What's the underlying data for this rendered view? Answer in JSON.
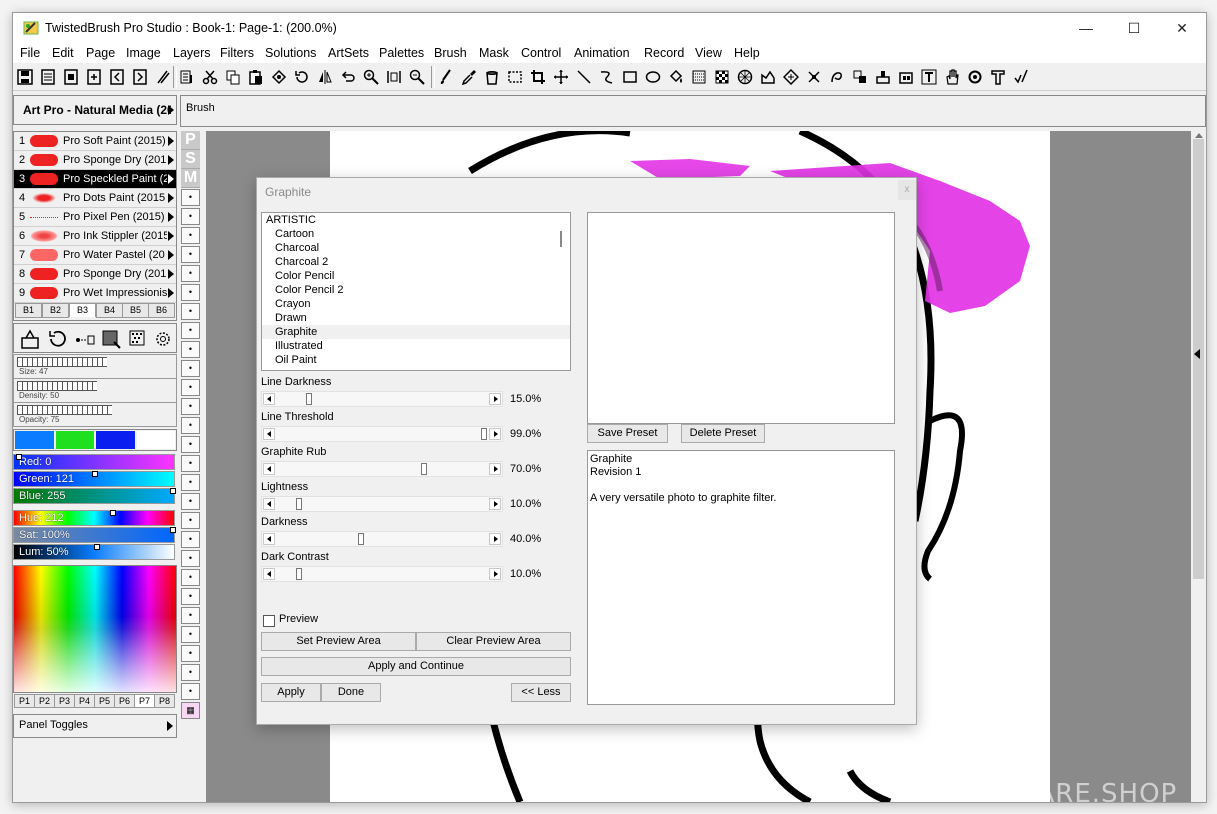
{
  "window": {
    "title": "TwistedBrush Pro Studio : Book-1: Page-1:  (200.0%)",
    "controls": {
      "minimize": "—",
      "maximize": "☐",
      "close": "✕"
    }
  },
  "menu": [
    "File",
    "Edit",
    "Page",
    "Image",
    "Layers",
    "Filters",
    "Solutions",
    "ArtSets",
    "Palettes",
    "Brush",
    "Mask",
    "Control",
    "Animation",
    "Record",
    "View",
    "Help"
  ],
  "artset": {
    "name": "Art Pro - Natural Media (20"
  },
  "brush_header": {
    "label": "Brush"
  },
  "brushes": [
    {
      "num": "1",
      "name": "Pro Soft Paint (2015)",
      "selected": false
    },
    {
      "num": "2",
      "name": "Pro Sponge Dry (201",
      "selected": false
    },
    {
      "num": "3",
      "name": "Pro Speckled Paint (2",
      "selected": true
    },
    {
      "num": "4",
      "name": "Pro Dots Paint (2015",
      "selected": false
    },
    {
      "num": "5",
      "name": "Pro Pixel Pen (2015)",
      "selected": false
    },
    {
      "num": "6",
      "name": "Pro Ink Stippler (2015",
      "selected": false
    },
    {
      "num": "7",
      "name": "Pro Water Pastel (20",
      "selected": false
    },
    {
      "num": "8",
      "name": "Pro Sponge Dry (201",
      "selected": false
    },
    {
      "num": "9",
      "name": "Pro Wet Impressionis",
      "selected": false
    }
  ],
  "brush_tabs": {
    "items": [
      "B1",
      "B2",
      "B3",
      "B4",
      "B5",
      "B6"
    ],
    "active": "B3"
  },
  "psm": [
    "P",
    "S",
    "M"
  ],
  "brush_settings": {
    "size": "Size: 47",
    "density": "Density: 50",
    "opacity": "Opacity: 75"
  },
  "swatches": [
    "#0a7cff",
    "#1fe01f",
    "#0a1ef0",
    "#ffffff"
  ],
  "color_sliders": {
    "red": "Red: 0",
    "green": "Green: 121",
    "blue": "Blue: 255",
    "hue": "Hue: 212",
    "sat": "Sat: 100%",
    "lum": "Lum: 50%"
  },
  "palette_tabs": {
    "items": [
      "P1",
      "P2",
      "P3",
      "P4",
      "P5",
      "P6",
      "P7",
      "P8"
    ],
    "active": "P7"
  },
  "panel_toggles": "Panel Toggles",
  "watermark": "THESOFTWARE.SHOP",
  "dialog": {
    "title": "Graphite",
    "close": "x",
    "filters": [
      "ARTISTIC",
      "Cartoon",
      "Charcoal",
      "Charcoal 2",
      "Color Pencil",
      "Color Pencil 2",
      "Crayon",
      "Drawn",
      "Graphite",
      "Illustrated",
      "Oil Paint"
    ],
    "selected_filter": "Graphite",
    "params": [
      {
        "label": "Line Darkness",
        "value": "15.0%",
        "fraction": 0.15
      },
      {
        "label": "Line Threshold",
        "value": "99.0%",
        "fraction": 0.99
      },
      {
        "label": "Graphite Rub",
        "value": "70.0%",
        "fraction": 0.7
      },
      {
        "label": "Lightness",
        "value": "10.0%",
        "fraction": 0.1
      },
      {
        "label": "Darkness",
        "value": "40.0%",
        "fraction": 0.4
      },
      {
        "label": "Dark Contrast",
        "value": "10.0%",
        "fraction": 0.1
      }
    ],
    "preview_label": "Preview",
    "buttons": {
      "set_preview": "Set Preview Area",
      "clear_preview": "Clear Preview Area",
      "apply_continue": "Apply and Continue",
      "apply": "Apply",
      "done": "Done",
      "less": "<< Less",
      "save_preset": "Save Preset",
      "delete_preset": "Delete Preset"
    },
    "description": {
      "name": "Graphite",
      "revision": "Revision 1",
      "text": "A very versatile photo to graphite filter."
    }
  }
}
